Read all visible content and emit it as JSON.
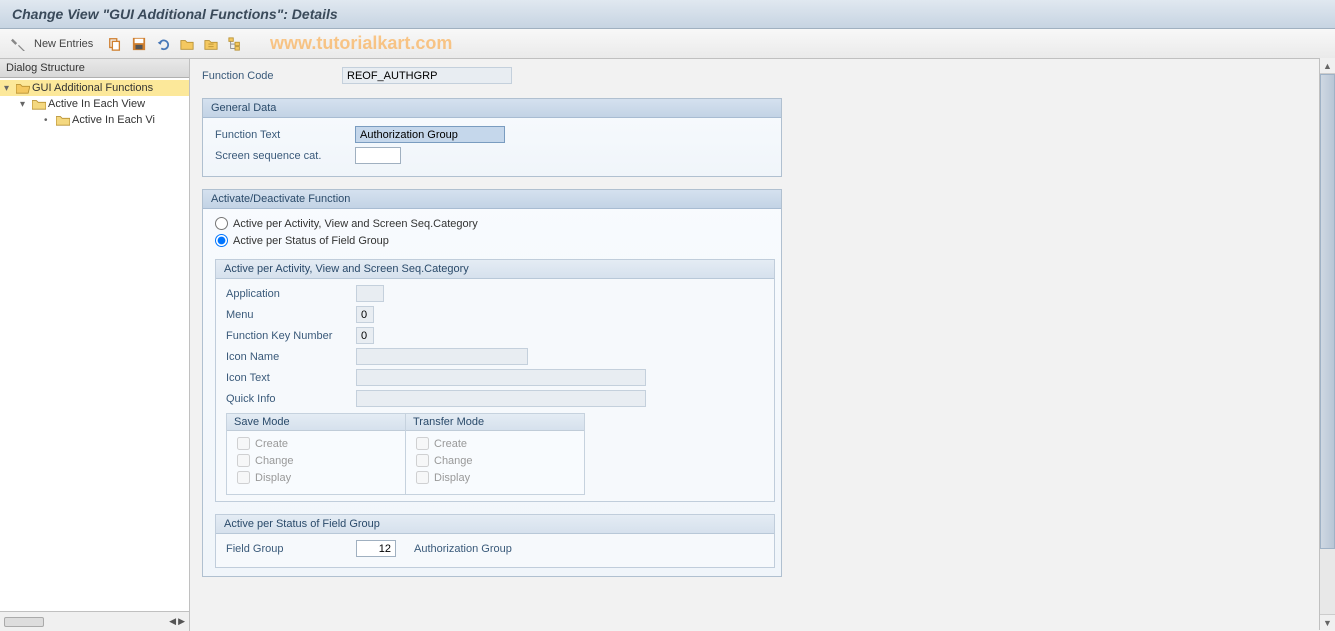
{
  "title": "Change View \"GUI Additional Functions\": Details",
  "watermark": "www.tutorialkart.com",
  "toolbar": {
    "new_entries_label": "New Entries"
  },
  "sidebar": {
    "header": "Dialog Structure",
    "items": [
      {
        "label": "GUI Additional Functions",
        "active": true,
        "indent": 0,
        "open": true
      },
      {
        "label": "Active In Each View",
        "active": false,
        "indent": 1,
        "open": true
      },
      {
        "label": "Active In Each Vi",
        "active": false,
        "indent": 2,
        "open": false
      }
    ]
  },
  "header": {
    "function_code_label": "Function Code",
    "function_code_value": "REOF_AUTHGRP"
  },
  "general_data": {
    "title": "General Data",
    "function_text_label": "Function Text",
    "function_text_value": "Authorization Group",
    "screen_seq_label": "Screen sequence cat.",
    "screen_seq_value": ""
  },
  "activate": {
    "title": "Activate/Deactivate Function",
    "option1": "Active per Activity, View and Screen Seq.Category",
    "option2": "Active per Status of Field Group",
    "inner1": {
      "title": "Active per Activity, View and Screen Seq.Category",
      "application_label": "Application",
      "application_value": "",
      "menu_label": "Menu",
      "menu_value": "0",
      "fkn_label": "Function Key Number",
      "fkn_value": "0",
      "icon_name_label": "Icon Name",
      "icon_name_value": "",
      "icon_text_label": "Icon Text",
      "icon_text_value": "",
      "quick_info_label": "Quick Info",
      "quick_info_value": "",
      "save_mode": {
        "title": "Save Mode",
        "create": "Create",
        "change": "Change",
        "display": "Display"
      },
      "transfer_mode": {
        "title": "Transfer Mode",
        "create": "Create",
        "change": "Change",
        "display": "Display"
      }
    },
    "inner2": {
      "title": "Active per Status of Field Group",
      "field_group_label": "Field Group",
      "field_group_value": "12",
      "field_group_text": "Authorization Group"
    }
  }
}
